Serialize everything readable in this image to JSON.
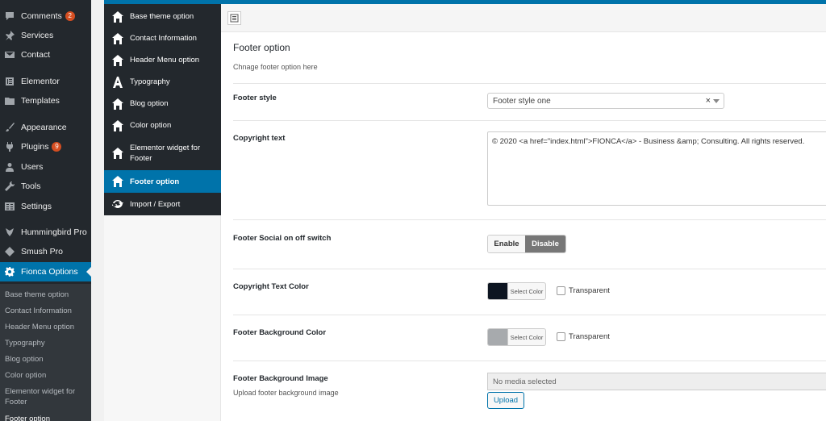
{
  "wp_menu": [
    {
      "label": "Comments",
      "badge": "2",
      "icon": "comment-icon"
    },
    {
      "label": "Services",
      "icon": "pin-icon"
    },
    {
      "label": "Contact",
      "icon": "mail-icon"
    },
    {
      "label": "Elementor",
      "icon": "elementor-icon"
    },
    {
      "label": "Templates",
      "icon": "folder-icon"
    },
    {
      "label": "Appearance",
      "icon": "brush-icon"
    },
    {
      "label": "Plugins",
      "badge": "9",
      "icon": "plug-icon"
    },
    {
      "label": "Users",
      "icon": "user-icon"
    },
    {
      "label": "Tools",
      "icon": "wrench-icon"
    },
    {
      "label": "Settings",
      "icon": "settings-icon"
    },
    {
      "label": "Hummingbird Pro",
      "icon": "hummingbird-icon"
    },
    {
      "label": "Smush Pro",
      "icon": "smush-icon"
    },
    {
      "label": "Fionca Options",
      "icon": "gear-icon"
    }
  ],
  "wp_submenu": [
    "Base theme option",
    "Contact Information",
    "Header Menu option",
    "Typography",
    "Blog option",
    "Color option",
    "Elementor widget for Footer",
    "Footer option"
  ],
  "options_menu": [
    {
      "label": "Base theme option",
      "icon": "home-icon"
    },
    {
      "label": "Contact Information",
      "icon": "home-icon"
    },
    {
      "label": "Header Menu option",
      "icon": "home-icon"
    },
    {
      "label": "Typography",
      "icon": "typography-icon"
    },
    {
      "label": "Blog option",
      "icon": "home-icon"
    },
    {
      "label": "Color option",
      "icon": "home-icon"
    },
    {
      "label": "Elementor widget for Footer",
      "icon": "home-icon"
    },
    {
      "label": "Footer option",
      "icon": "home-icon"
    },
    {
      "label": "Import / Export",
      "icon": "refresh-icon"
    }
  ],
  "section": {
    "title": "Footer option",
    "description": "Chnage footer option here"
  },
  "fields": {
    "footer_style": {
      "label": "Footer style",
      "value": "Footer style one",
      "clear": "×"
    },
    "copyright_text": {
      "label": "Copyright text",
      "value": "© 2020 <a href=\"index.html\">FIONCA</a> - Business &amp; Consulting. All rights reserved."
    },
    "social_switch": {
      "label": "Footer Social on off switch",
      "on": "Enable",
      "off": "Disable"
    },
    "copyright_color": {
      "label": "Copyright Text Color",
      "button": "Select Color",
      "color": "#0d1521",
      "transparent": "Transparent"
    },
    "bg_color": {
      "label": "Footer Background Color",
      "button": "Select Color",
      "color": "#a7aaad",
      "transparent": "Transparent"
    },
    "bg_image": {
      "label": "Footer Background Image",
      "subtitle": "Upload footer background image",
      "placeholder": "No media selected",
      "button": "Upload"
    }
  }
}
